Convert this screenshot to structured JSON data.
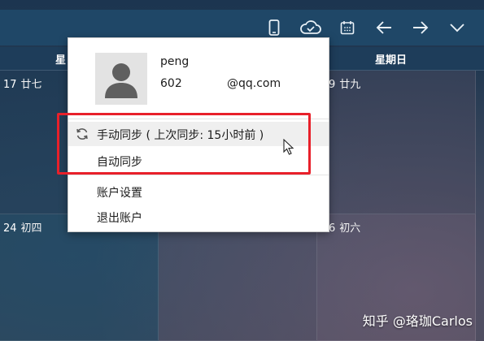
{
  "week_header": {
    "days": [
      "星",
      "星期日"
    ]
  },
  "calendar": {
    "cells": [
      {
        "day": "17",
        "lunar": "廿七"
      },
      {
        "day": "9",
        "lunar": "廿九"
      },
      {
        "day": "24",
        "lunar": "初四"
      },
      {
        "day": "6",
        "lunar": "初六"
      }
    ]
  },
  "account_popup": {
    "username": "peng",
    "email_part1": "602",
    "email_part2": "@qq.com",
    "menu": {
      "manual_sync": "手动同步 ( 上次同步: 15小时前 )",
      "auto_sync": "自动同步",
      "account_settings": "账户设置",
      "sign_out": "退出账户"
    }
  },
  "toolbar_icons": [
    "phone-icon",
    "cloud-sync-icon",
    "calendar-icon",
    "arrow-left-icon",
    "arrow-right-icon",
    "chevron-down-icon"
  ],
  "watermark": "知乎 @珞珈Carlos",
  "colors": {
    "highlight": "#e8202a",
    "topbar": "#1f4767",
    "popup_bg": "#ffffff"
  }
}
